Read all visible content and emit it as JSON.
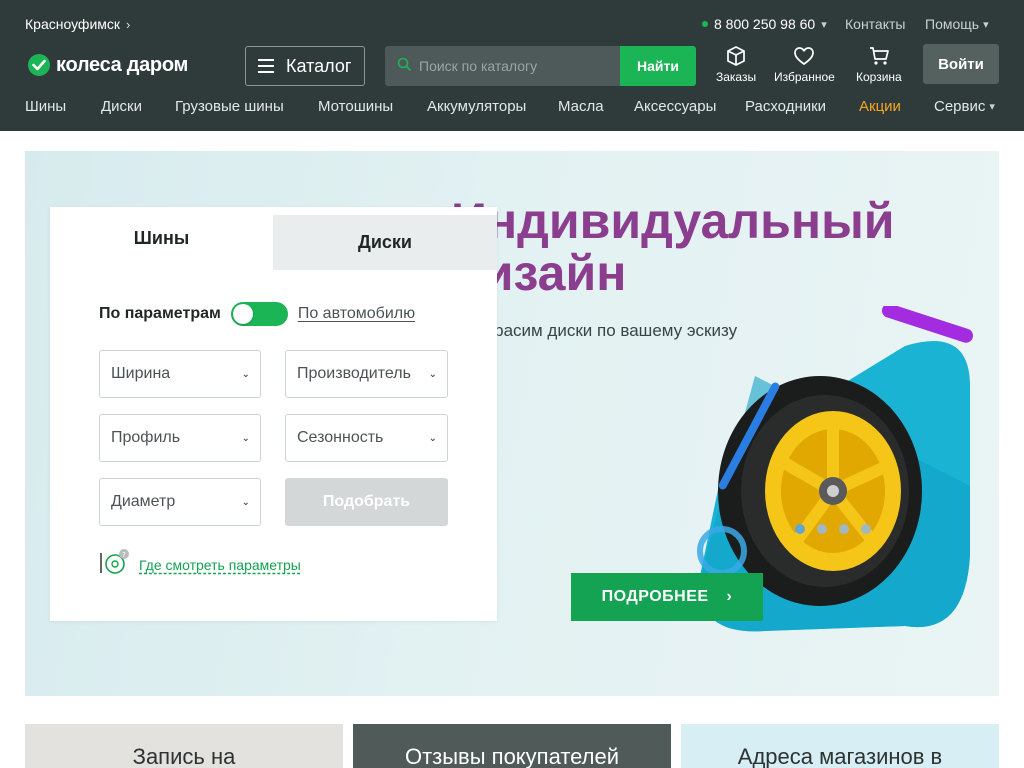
{
  "header": {
    "city": "Красноуфимск",
    "phone": "8 800 250 98 60",
    "contacts": "Контакты",
    "help": "Помощь",
    "logo_text": "колеса даром",
    "catalog_label": "Каталог",
    "search": {
      "placeholder": "Поиск по каталогу",
      "button": "Найти"
    },
    "icons": {
      "orders": "Заказы",
      "favorites": "Избранное",
      "cart": "Корзина"
    },
    "login": "Войти"
  },
  "nav": {
    "items": [
      "Шины",
      "Диски",
      "Грузовые шины",
      "Мотошины",
      "Аккумуляторы",
      "Масла",
      "Аксессуары",
      "Расходники",
      "Акции",
      "Сервис"
    ]
  },
  "banner": {
    "title_line1": "Индивидуальный",
    "title_line2": "дизайн",
    "subtitle": "Покрасим диски по вашему эскизу",
    "button": "ПОДРОБНЕЕ"
  },
  "filter": {
    "tabs": [
      "Шины",
      "Диски"
    ],
    "mode_label": "По параметрам",
    "mode_alt": "По автомобилю",
    "selects": {
      "width": "Ширина",
      "maker": "Производитель",
      "profile": "Профиль",
      "season": "Сезонность",
      "diameter": "Диаметр"
    },
    "pick_button": "Подобрать",
    "where_link": "Где смотреть параметры"
  },
  "bottom_cards": [
    "Запись на",
    "Отзывы покупателей",
    "Адреса магазинов в"
  ],
  "colors": {
    "header_bg": "#2f3b3b",
    "accent_green": "#1bb556",
    "promo_orange": "#f5a623",
    "title_purple": "#8b3d8e"
  }
}
